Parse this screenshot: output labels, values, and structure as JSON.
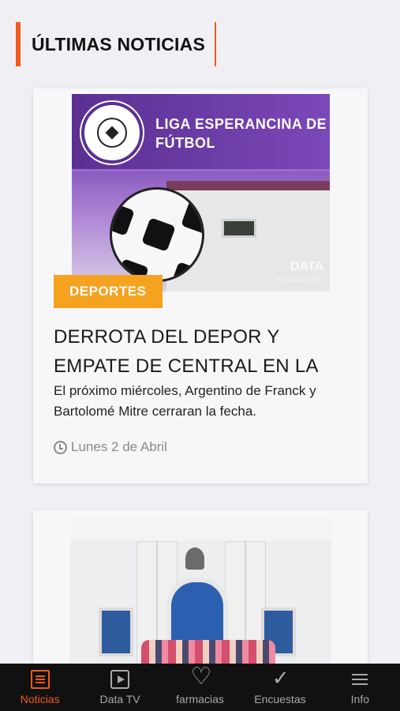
{
  "section": {
    "title": "ÚLTIMAS NOTICIAS"
  },
  "articles": [
    {
      "image": {
        "banner_text": "LIGA ESPERANCINA DE FÚTBOL",
        "watermark": "DATA",
        "watermark_sub": "SANCARLOS"
      },
      "category": "DEPORTES",
      "headline": "DERROTA DEL DEPOR Y EMPATE DE CENTRAL EN LA",
      "summary": "El próximo miércoles, Argentino de Franck y Bartolomé Mitre cerraran la fecha.",
      "date": "Lunes 2 de Abril"
    },
    {
      "image": {}
    }
  ],
  "tabbar": {
    "tabs": [
      {
        "label": "Noticias",
        "icon": "news-icon",
        "active": true
      },
      {
        "label": "Data TV",
        "icon": "play-icon",
        "active": false
      },
      {
        "label": "farmacias",
        "icon": "heart-icon",
        "active": false
      },
      {
        "label": "Encuestas",
        "icon": "check-icon",
        "active": false
      },
      {
        "label": "Info",
        "icon": "menu-icon",
        "active": false
      }
    ]
  },
  "colors": {
    "accent": "#f05a1a",
    "category_badge": "#f5a21f",
    "tabbar_bg": "#111111"
  }
}
